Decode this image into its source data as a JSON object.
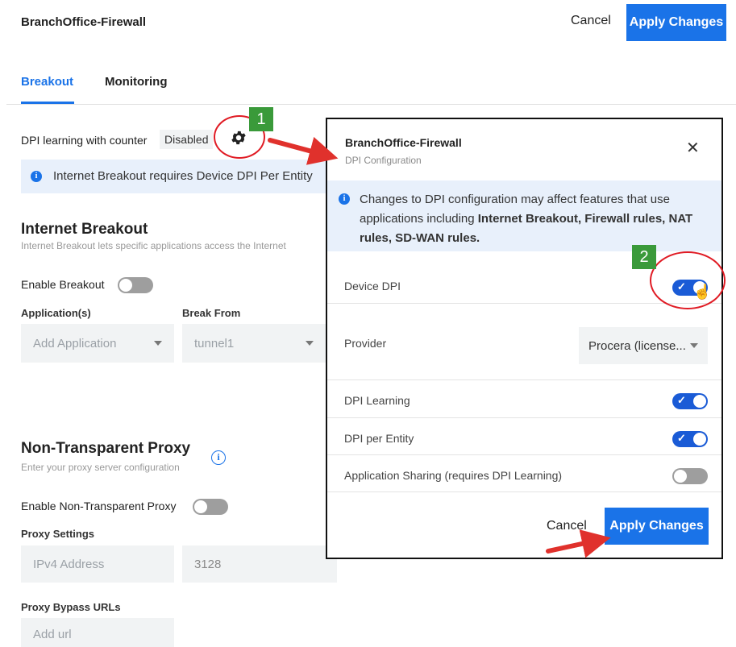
{
  "header": {
    "title": "BranchOffice-Firewall",
    "cancel_label": "Cancel",
    "apply_label": "Apply Changes"
  },
  "tabs": [
    {
      "label": "Breakout",
      "active": true
    },
    {
      "label": "Monitoring",
      "active": false
    }
  ],
  "dpi_counter": {
    "label": "DPI learning with counter",
    "status": "Disabled"
  },
  "info_banner": {
    "text": "Internet Breakout requires Device DPI Per Entity"
  },
  "internet_breakout": {
    "title": "Internet Breakout",
    "description": "Internet Breakout lets specific applications access the Internet",
    "enable_label": "Enable Breakout",
    "enabled": false,
    "applications_header": "Application(s)",
    "application_placeholder": "Add Application",
    "break_from_header": "Break From",
    "break_from_value": "tunnel1"
  },
  "proxy": {
    "title": "Non-Transparent Proxy",
    "description": "Enter your proxy server configuration",
    "enable_label": "Enable Non-Transparent Proxy",
    "enabled": false,
    "settings_header": "Proxy Settings",
    "ipv4_placeholder": "IPv4 Address",
    "port_value": "3128",
    "bypass_header": "Proxy Bypass URLs",
    "url_placeholder": "Add url"
  },
  "modal": {
    "title": "BranchOffice-Firewall",
    "subtitle": "DPI Configuration",
    "info_prefix": "Changes to DPI configuration may affect features that use applications including ",
    "info_bold": "Internet Breakout, Firewall rules, NAT rules, SD-WAN rules.",
    "rows": [
      {
        "label": "Device DPI",
        "enabled": true
      },
      {
        "label": "Provider",
        "value": "Procera (license..."
      },
      {
        "label": "DPI Learning",
        "enabled": true
      },
      {
        "label": "DPI per Entity",
        "enabled": true
      },
      {
        "label": "Application Sharing (requires DPI Learning)",
        "enabled": false
      }
    ],
    "cancel_label": "Cancel",
    "apply_label": "Apply Changes"
  },
  "annotations": {
    "step1": "1",
    "step2": "2",
    "color": "#e01b24",
    "badge_color": "#3a9a3a"
  },
  "colors": {
    "accent": "#1a73e8",
    "info_bg": "#e8f0fb",
    "toggle_on": "#1a5bd6",
    "toggle_off": "#9e9e9e"
  }
}
